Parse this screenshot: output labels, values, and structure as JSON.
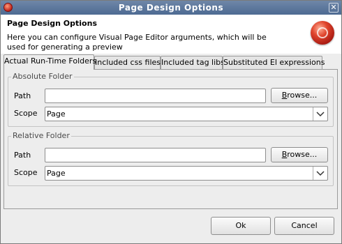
{
  "window": {
    "title": "Page Design Options",
    "close_glyph": "✕"
  },
  "header": {
    "title": "Page Design Options",
    "description": "Here you can configure Visual Page Editor arguments, which will be used for generating a preview"
  },
  "tabs": [
    {
      "label": "Actual Run-Time Folders",
      "active": true
    },
    {
      "label": "Included css files",
      "active": false
    },
    {
      "label": "Included tag libs",
      "active": false
    },
    {
      "label": "Substituted El expressions",
      "active": false
    }
  ],
  "absolute_folder": {
    "group_label": "Absolute Folder",
    "path_label": "Path",
    "path_value": "",
    "browse_mnemonic": "B",
    "browse_rest": "rowse...",
    "scope_label": "Scope",
    "scope_value": "Page"
  },
  "relative_folder": {
    "group_label": "Relative Folder",
    "path_label": "Path",
    "path_value": "",
    "browse_mnemonic": "B",
    "browse_rest": "rowse...",
    "scope_label": "Scope",
    "scope_value": "Page"
  },
  "buttons": {
    "ok": "Ok",
    "cancel": "Cancel"
  },
  "colors": {
    "titlebar": "#5a7499",
    "background": "#ededed",
    "header_bg": "#ffffff"
  },
  "icons": {
    "app": "jboss-red-ball-icon",
    "logo": "visual-page-editor-logo",
    "close": "close-icon",
    "dropdown": "chevron-down-icon"
  }
}
